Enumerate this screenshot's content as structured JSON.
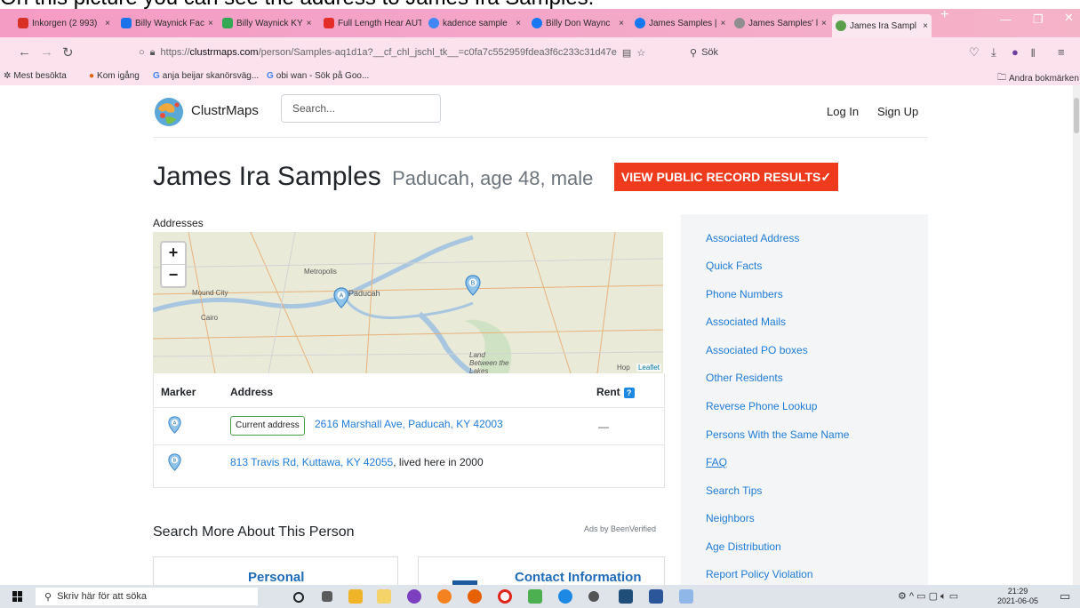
{
  "caption": "On this picture you can see the address to James Ira Samples.",
  "browser": {
    "tabs": [
      {
        "label": "Inkorgen (2 993)",
        "color": "#d93025"
      },
      {
        "label": "Billy Waynick Fac",
        "color": "#1a73e8"
      },
      {
        "label": "Billy Waynick KY",
        "color": "#34a853"
      },
      {
        "label": "Full Length Hear AUTOMATISK UPPSPEL",
        "color": "#e52d27"
      },
      {
        "label": "kadence sample",
        "color": "#4285f4"
      },
      {
        "label": "Billy Don Waync",
        "color": "#1877f2"
      },
      {
        "label": "James Samples |",
        "color": "#1877f2"
      },
      {
        "label": "James Samples' l",
        "color": "#8e8e8e"
      },
      {
        "label": "James Ira Sampl",
        "color": "#5aa04a"
      }
    ],
    "url_prefix": "https://",
    "url_domain": "clustrmaps.com",
    "url_rest": "/person/Samples-aq1d1a?__cf_chl_jschl_tk__=c0fa7c552959fdea3f6c233c31d47e",
    "search_placeholder": "Sök",
    "bookmarks": [
      {
        "label": "Mest besökta",
        "icon": "gear-icon"
      },
      {
        "label": "Kom igång",
        "icon": "firefox-icon"
      },
      {
        "label": "anja beijar skanörsväg...",
        "icon": "google-icon"
      },
      {
        "label": "obi wan - Sök på Goo...",
        "icon": "google-icon"
      }
    ],
    "other_bookmarks": "Andra bokmärken"
  },
  "site": {
    "brand": "ClustrMaps",
    "search_placeholder": "Search...",
    "login": "Log In",
    "signup": "Sign Up"
  },
  "person": {
    "name": "James Ira Samples",
    "details": "Paducah, age 48, male",
    "cta": "VIEW PUBLIC RECORD RESULTS✓"
  },
  "addresses": {
    "title": "Addresses",
    "map_labels": [
      "Metropolis",
      "Mound City",
      "Paducah",
      "Cairo",
      "Land Between the Lakes",
      "Hop"
    ],
    "attribution": "Leaflet",
    "zoom_in": "+",
    "zoom_out": "−",
    "headers": {
      "marker": "Marker",
      "address": "Address",
      "rent": "Rent"
    },
    "rows": [
      {
        "marker": "A",
        "badge": "Current address",
        "address": "2616 Marshall Ave, Paducah, KY 42003",
        "extra": "",
        "rent": "—"
      },
      {
        "marker": "B",
        "badge": "",
        "address": "813 Travis Rd, Kuttawa, KY 42055",
        "extra": ", lived here in 2000",
        "rent": ""
      }
    ]
  },
  "more": {
    "title": "Search More About This Person",
    "ads": "Ads by BeenVerified",
    "cards": [
      "Personal",
      "Contact Information"
    ]
  },
  "sidebar": [
    "Associated Address",
    "Quick Facts",
    "Phone Numbers",
    "Associated Mails",
    "Associated PO boxes",
    "Other Residents",
    "Reverse Phone Lookup",
    "Persons With the Same Name",
    "FAQ",
    "Search Tips",
    "Neighbors",
    "Age Distribution",
    "Report Policy Violation"
  ],
  "taskbar": {
    "search_placeholder": "Skriv här för att söka",
    "time": "21:29",
    "date": "2021-06-05"
  }
}
